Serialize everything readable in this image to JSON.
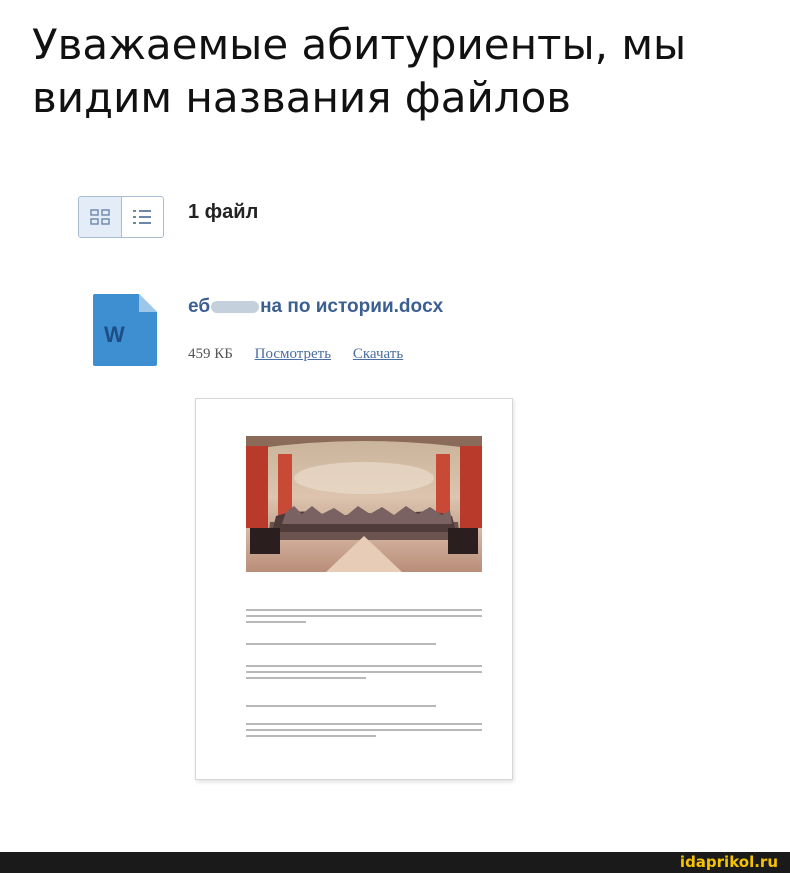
{
  "caption": {
    "line1": "Уважаемые абитуриенты, мы",
    "line2": "видим названия файлов"
  },
  "toolbar": {
    "grid_view_icon": "grid-view-icon",
    "list_view_icon": "list-view-icon",
    "file_count": "1 файл"
  },
  "file": {
    "icon": "word-document-icon",
    "icon_letter": "W",
    "name_prefix": "еб",
    "name_suffix": "на по истории.docx",
    "size": "459 КБ",
    "view_link": "Посмотреть",
    "download_link": "Скачать"
  },
  "colors": {
    "link": "#4a6ea0",
    "file_name": "#3c5f92",
    "word_icon": "#3d8fd1",
    "watermark": "#f5c200"
  },
  "watermark": "idaprikol.ru"
}
